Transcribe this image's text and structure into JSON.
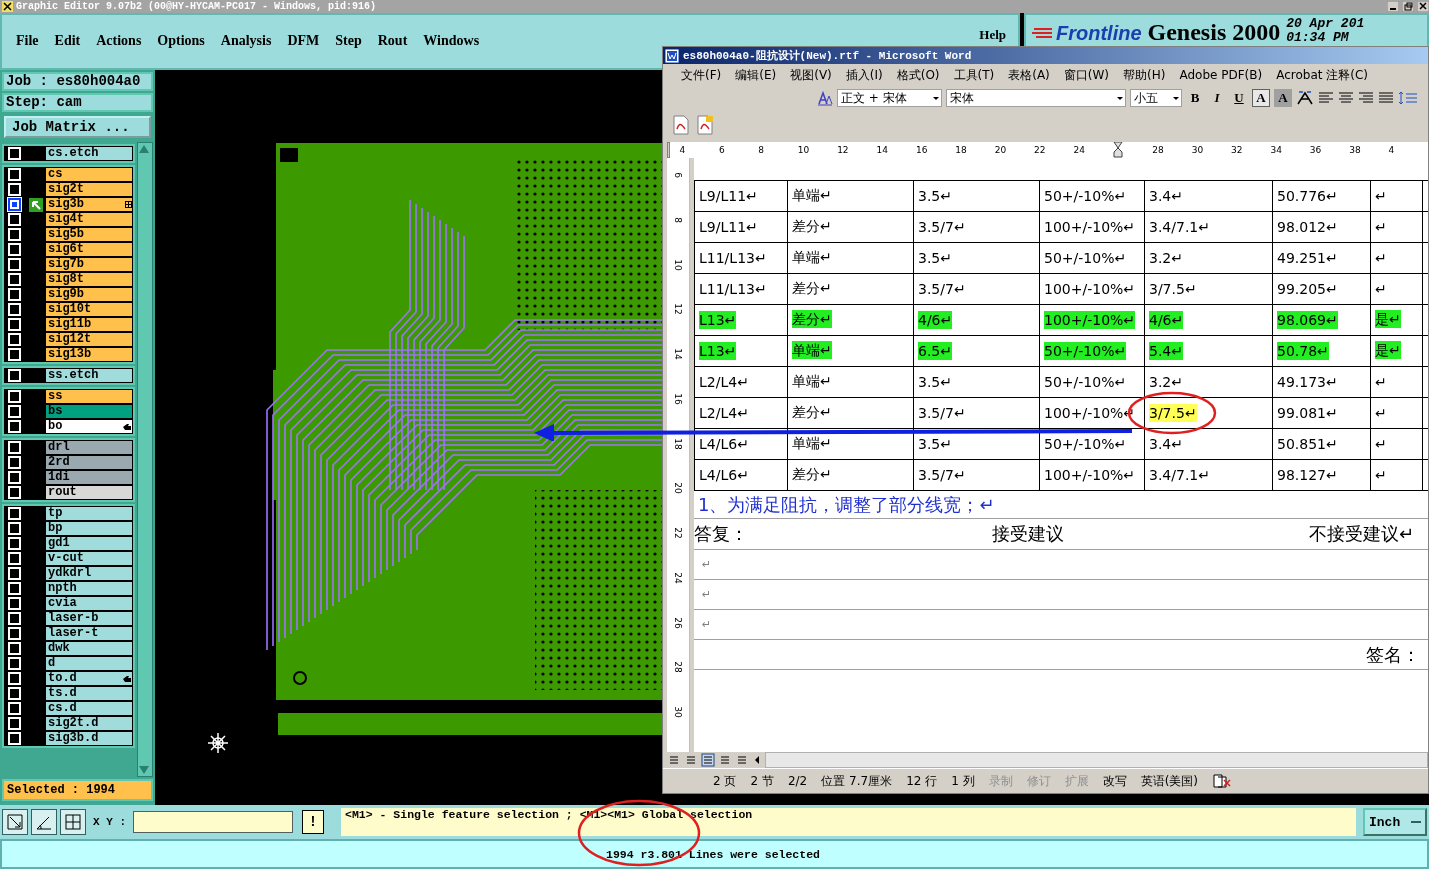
{
  "app_title": "Graphic Editor 9.07b2 (00@HY-HYCAM-PC017 - Windows, pid:916)",
  "menu": [
    "File",
    "Edit",
    "Actions",
    "Options",
    "Analysis",
    "DFM",
    "Step",
    "Rout",
    "Windows"
  ],
  "help": "Help",
  "brand": {
    "logo": "Frontline",
    "product": "Genesis 2000",
    "date": "20 Apr 201",
    "time": "01:34 PM"
  },
  "job": {
    "job": "Job : es80h004a0",
    "step": "Step: cam",
    "matrix_button": "Job Matrix ..."
  },
  "layer_groups": [
    {
      "layers": [
        {
          "name": "cs.etch",
          "color": "#a0dcdc",
          "selected": false,
          "hand_mark": false
        }
      ]
    },
    {
      "layers": [
        {
          "name": "cs",
          "color": "#ffc04c",
          "selected": false,
          "hand_mark": false
        },
        {
          "name": "sig2t",
          "color": "#ffc04c",
          "selected": false,
          "hand_mark": false
        },
        {
          "name": "sig3b",
          "color": "#ffc04c",
          "selected": true,
          "hand_mark": false
        },
        {
          "name": "sig4t",
          "color": "#ffc04c",
          "selected": false,
          "hand_mark": false
        },
        {
          "name": "sig5b",
          "color": "#ffc04c",
          "selected": false,
          "hand_mark": false
        },
        {
          "name": "sig6t",
          "color": "#ffc04c",
          "selected": false,
          "hand_mark": false
        },
        {
          "name": "sig7b",
          "color": "#ffc04c",
          "selected": false,
          "hand_mark": false
        },
        {
          "name": "sig8t",
          "color": "#ffc04c",
          "selected": false,
          "hand_mark": false
        },
        {
          "name": "sig9b",
          "color": "#ffc04c",
          "selected": false,
          "hand_mark": false
        },
        {
          "name": "sig10t",
          "color": "#ffc04c",
          "selected": false,
          "hand_mark": false
        },
        {
          "name": "sig11b",
          "color": "#ffc04c",
          "selected": false,
          "hand_mark": false
        },
        {
          "name": "sig12t",
          "color": "#ffc04c",
          "selected": false,
          "hand_mark": false
        },
        {
          "name": "sig13b",
          "color": "#ffc04c",
          "selected": false,
          "hand_mark": false
        }
      ]
    },
    {
      "layers": [
        {
          "name": "ss.etch",
          "color": "#a0dcdc",
          "selected": false,
          "hand_mark": false
        }
      ]
    },
    {
      "layers": [
        {
          "name": "ss",
          "color": "#ffc04c",
          "selected": false,
          "hand_mark": false
        },
        {
          "name": "bs",
          "color": "#00a080",
          "selected": false,
          "hand_mark": false
        },
        {
          "name": "bo",
          "color": "#ffffff",
          "selected": false,
          "hand_mark": true
        }
      ]
    },
    {
      "layers": [
        {
          "name": "drl",
          "color": "#9aa8b0",
          "selected": false,
          "hand_mark": false
        },
        {
          "name": "2rd",
          "color": "#9aa8b0",
          "selected": false,
          "hand_mark": false
        },
        {
          "name": "1di",
          "color": "#9aa8b0",
          "selected": false,
          "hand_mark": false
        },
        {
          "name": "rout",
          "color": "#d8d8d8",
          "selected": false,
          "hand_mark": false
        }
      ]
    },
    {
      "layers": [
        {
          "name": "tp",
          "color": "#a0dcdc",
          "selected": false,
          "hand_mark": false
        },
        {
          "name": "bp",
          "color": "#a0dcdc",
          "selected": false,
          "hand_mark": false
        },
        {
          "name": "gd1",
          "color": "#a0dcdc",
          "selected": false,
          "hand_mark": false
        },
        {
          "name": "v-cut",
          "color": "#a0dcdc",
          "selected": false,
          "hand_mark": false
        },
        {
          "name": "ydkdrl",
          "color": "#a0dcdc",
          "selected": false,
          "hand_mark": false
        },
        {
          "name": "npth",
          "color": "#a0dcdc",
          "selected": false,
          "hand_mark": false
        },
        {
          "name": "cvia",
          "color": "#a0dcdc",
          "selected": false,
          "hand_mark": false
        },
        {
          "name": "laser-b",
          "color": "#a0dcdc",
          "selected": false,
          "hand_mark": false
        },
        {
          "name": "laser-t",
          "color": "#a0dcdc",
          "selected": false,
          "hand_mark": false
        },
        {
          "name": "dwk",
          "color": "#a0dcdc",
          "selected": false,
          "hand_mark": false
        },
        {
          "name": "d",
          "color": "#a0dcdc",
          "selected": false,
          "hand_mark": false
        },
        {
          "name": "to.d",
          "color": "#a0dcdc",
          "selected": false,
          "hand_mark": true
        },
        {
          "name": "ts.d",
          "color": "#a0dcdc",
          "selected": false,
          "hand_mark": false
        },
        {
          "name": "cs.d",
          "color": "#a0dcdc",
          "selected": false,
          "hand_mark": false
        },
        {
          "name": "sig2t.d",
          "color": "#a0dcdc",
          "selected": false,
          "hand_mark": false
        },
        {
          "name": "sig3b.d",
          "color": "#a0dcdc",
          "selected": false,
          "hand_mark": false
        }
      ]
    }
  ],
  "selected_count": "Selected : 1994",
  "word": {
    "title": "es80h004a0-阻抗设计(New).rtf - Microsoft Word",
    "menu": [
      "文件(F)",
      "编辑(E)",
      "视图(V)",
      "插入(I)",
      "格式(O)",
      "工具(T)",
      "表格(A)",
      "窗口(W)",
      "帮助(H)",
      "Adobe PDF(B)",
      "Acrobat 注释(C)"
    ],
    "style": "正文 + 宋体",
    "font": "宋体",
    "size": "小五",
    "format_buttons": [
      "B",
      "I",
      "U",
      "A",
      "A"
    ],
    "ruler": [
      {
        "kind": "number",
        "text": "4"
      },
      {
        "kind": "number",
        "text": "6"
      },
      {
        "kind": "number",
        "text": "8"
      },
      {
        "kind": "number",
        "text": "10"
      },
      {
        "kind": "number",
        "text": "12"
      },
      {
        "kind": "number",
        "text": "14"
      },
      {
        "kind": "number",
        "text": "16"
      },
      {
        "kind": "number",
        "text": "18"
      },
      {
        "kind": "number",
        "text": "20"
      },
      {
        "kind": "number",
        "text": "22"
      },
      {
        "kind": "number",
        "text": "24"
      },
      {
        "kind": "marker"
      },
      {
        "kind": "number",
        "text": "28"
      },
      {
        "kind": "number",
        "text": "30"
      },
      {
        "kind": "number",
        "text": "32"
      },
      {
        "kind": "number",
        "text": "34"
      },
      {
        "kind": "number",
        "text": "36"
      },
      {
        "kind": "number",
        "text": "38"
      },
      {
        "kind": "number",
        "text": "4"
      }
    ],
    "vertical_ruler": [
      "6",
      "8",
      "10",
      "12",
      "14",
      "16",
      "18",
      "20",
      "22",
      "24",
      "26",
      "28",
      "30"
    ],
    "rows": [
      {
        "cells": [
          {
            "text": "L9/L11↵"
          },
          {
            "text": "单端↵"
          },
          {
            "text": "3.5↵"
          },
          {
            "text": "50+/-10%↵"
          },
          {
            "text": "3.4↵"
          },
          {
            "text": "50.776↵"
          },
          {
            "text": "↵"
          }
        ]
      },
      {
        "cells": [
          {
            "text": "L9/L11↵"
          },
          {
            "text": "差分↵"
          },
          {
            "text": "3.5/7↵"
          },
          {
            "text": "100+/-10%↵"
          },
          {
            "text": "3.4/7.1↵"
          },
          {
            "text": "98.012↵"
          },
          {
            "text": "↵"
          }
        ]
      },
      {
        "cells": [
          {
            "text": "L11/L13↵"
          },
          {
            "text": "单端↵"
          },
          {
            "text": "3.5↵"
          },
          {
            "text": "50+/-10%↵"
          },
          {
            "text": "3.2↵"
          },
          {
            "text": "49.251↵"
          },
          {
            "text": "↵"
          }
        ]
      },
      {
        "cells": [
          {
            "text": "L11/L13↵"
          },
          {
            "text": "差分↵"
          },
          {
            "text": "3.5/7↵"
          },
          {
            "text": "100+/-10%↵"
          },
          {
            "text": "3/7.5↵"
          },
          {
            "text": "99.205↵"
          },
          {
            "text": "↵"
          }
        ]
      },
      {
        "cells": [
          {
            "text": "L13↵",
            "color": "#22ee22"
          },
          {
            "text": "差分↵",
            "color": "#22ee22"
          },
          {
            "text": "4/6↵",
            "color": "#22ee22"
          },
          {
            "text": "100+/-10%↵",
            "color": "#22ee22"
          },
          {
            "text": "4/6↵",
            "color": "#22ee22"
          },
          {
            "text": "98.069↵",
            "color": "#22ee22"
          },
          {
            "text": "是↵",
            "color": "#22ee22"
          }
        ]
      },
      {
        "cells": [
          {
            "text": "L13↵",
            "color": "#22ee22"
          },
          {
            "text": "单端↵",
            "color": "#22ee22"
          },
          {
            "text": "6.5↵",
            "color": "#22ee22"
          },
          {
            "text": "50+/-10%↵",
            "color": "#22ee22"
          },
          {
            "text": "5.4↵",
            "color": "#22ee22"
          },
          {
            "text": "50.78↵",
            "color": "#22ee22"
          },
          {
            "text": "是↵",
            "color": "#22ee22"
          }
        ]
      },
      {
        "cells": [
          {
            "text": "L2/L4↵"
          },
          {
            "text": "单端↵"
          },
          {
            "text": "3.5↵"
          },
          {
            "text": "50+/-10%↵"
          },
          {
            "text": "3.2↵"
          },
          {
            "text": "49.173↵"
          },
          {
            "text": "↵"
          }
        ]
      },
      {
        "cells": [
          {
            "text": "L2/L4↵"
          },
          {
            "text": "差分↵"
          },
          {
            "text": "3.5/7↵"
          },
          {
            "text": "100+/-10%↵"
          },
          {
            "text": "3/7.5↵",
            "color": "#ffff55"
          },
          {
            "text": "99.081↵"
          },
          {
            "text": "↵"
          }
        ]
      },
      {
        "cells": [
          {
            "text": "L4/L6↵"
          },
          {
            "text": "单端↵"
          },
          {
            "text": "3.5↵"
          },
          {
            "text": "50+/-10%↵"
          },
          {
            "text": "3.4↵"
          },
          {
            "text": "50.851↵"
          },
          {
            "text": "↵"
          }
        ]
      },
      {
        "cells": [
          {
            "text": "L4/L6↵"
          },
          {
            "text": "差分↵"
          },
          {
            "text": "3.5/7↵"
          },
          {
            "text": "100+/-10%↵"
          },
          {
            "text": "3.4/7.1↵"
          },
          {
            "text": "98.127↵"
          },
          {
            "text": "↵"
          }
        ]
      }
    ],
    "note": "1、为满足阻抗，调整了部分线宽；↵",
    "reply": [
      "答复：",
      "接受建议",
      "不接受建议↵"
    ],
    "blank_lines": [
      "↵",
      "↵",
      "↵"
    ],
    "signature": "签名：",
    "status": [
      {
        "text": "2 页",
        "disabled": false
      },
      {
        "text": "2 节",
        "disabled": false
      },
      {
        "text": "2/2",
        "disabled": false
      },
      {
        "text": "位置 7.7厘米",
        "disabled": false
      },
      {
        "text": "12 行",
        "disabled": false
      },
      {
        "text": "1 列",
        "disabled": false
      },
      {
        "text": "录制",
        "disabled": true
      },
      {
        "text": "修订",
        "disabled": true
      },
      {
        "text": "扩展",
        "disabled": true
      },
      {
        "text": "改写",
        "disabled": false
      },
      {
        "text": "英语(美国)",
        "disabled": false
      }
    ]
  },
  "toolbar": {
    "xy_label": "X Y :",
    "alert_button": "!",
    "message": "<M1> - Single feature selection ; <M1><M1> Global selection",
    "units": "Inch"
  },
  "status_line": "1994 r3.801 Lines were selected",
  "annotations": [
    {
      "kind": "ellipse"
    },
    {
      "kind": "ellipse"
    },
    {
      "kind": "arrow"
    }
  ]
}
